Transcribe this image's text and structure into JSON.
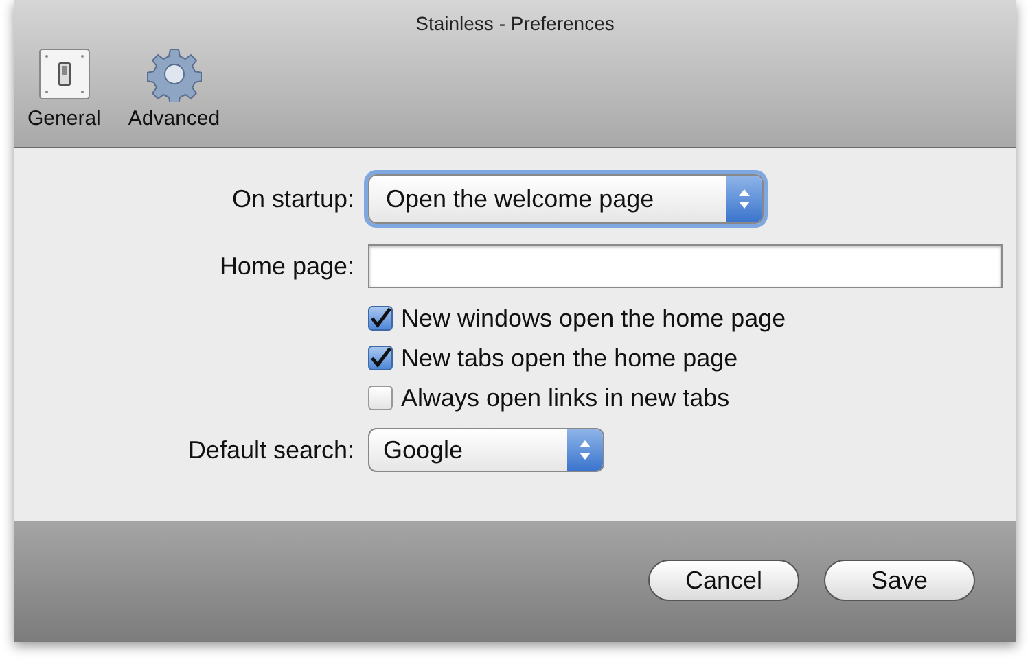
{
  "window": {
    "title": "Stainless - Preferences"
  },
  "toolbar": [
    {
      "label": "General",
      "kind": "switch"
    },
    {
      "label": "Advanced",
      "kind": "gear"
    }
  ],
  "on_startup": {
    "label": "On startup:",
    "value": "Open the welcome page",
    "focused": true
  },
  "home_page": {
    "label": "Home page:"
  },
  "options": [
    {
      "label": "New windows open the home page",
      "checked": true
    },
    {
      "label": "New tabs open the home page",
      "checked": true
    },
    {
      "label": "Always open links in new tabs",
      "checked": false
    }
  ],
  "default_search": {
    "label": "Default search:",
    "value": "Google",
    "focused": false
  },
  "buttons": [
    "Cancel",
    "Save"
  ]
}
